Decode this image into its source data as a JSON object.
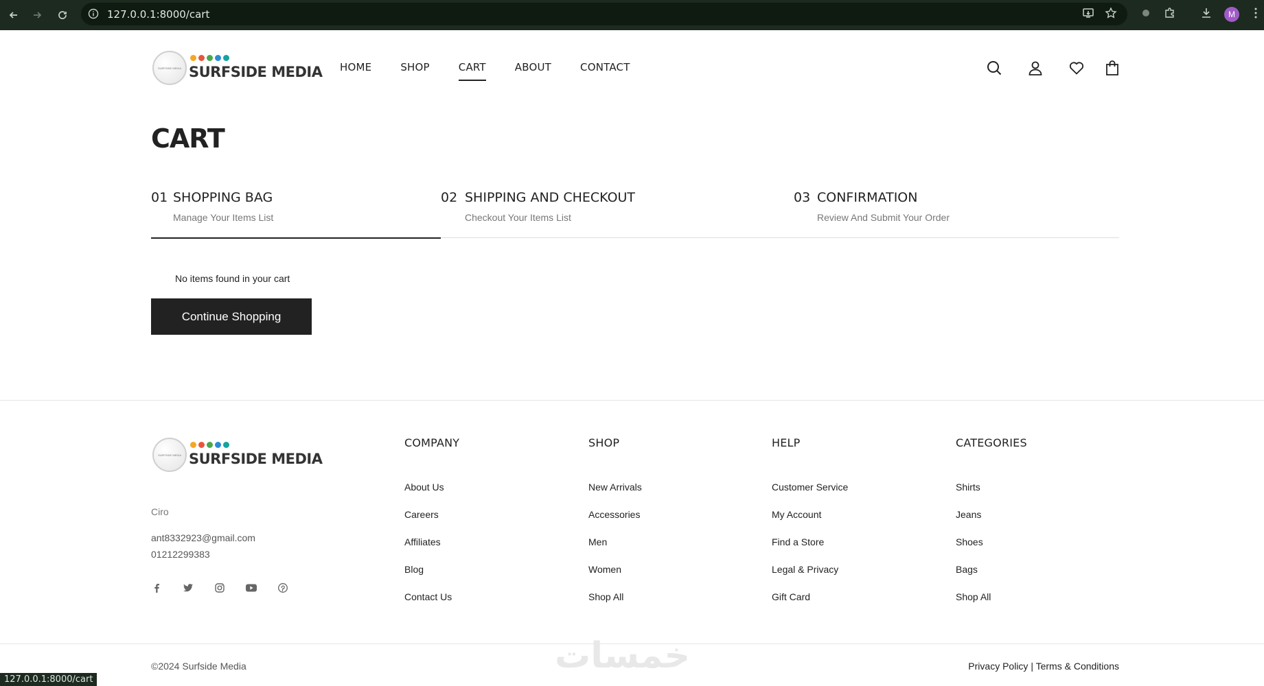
{
  "browser": {
    "url": "127.0.0.1:8000/cart",
    "profile_initial": "M",
    "status_url": "127.0.0.1:8000/cart"
  },
  "brand": {
    "wordmark": "SURFSIDE MEDIA",
    "badge_text": "SURFSIDE MEDIA",
    "dot_colors": [
      "#f5a623",
      "#e8553d",
      "#4aa84f",
      "#2b8bd6",
      "#17a2a2"
    ]
  },
  "nav": {
    "items": [
      {
        "label": "HOME"
      },
      {
        "label": "SHOP"
      },
      {
        "label": "CART"
      },
      {
        "label": "ABOUT"
      },
      {
        "label": "CONTACT"
      }
    ],
    "active": "CART"
  },
  "header_icons": [
    "search-icon",
    "user-icon",
    "heart-icon",
    "bag-icon"
  ],
  "page": {
    "title": "CART",
    "steps": [
      {
        "num": "01",
        "title": "SHOPPING BAG",
        "subtitle": "Manage Your Items List"
      },
      {
        "num": "02",
        "title": "SHIPPING AND CHECKOUT",
        "subtitle": "Checkout Your Items List"
      },
      {
        "num": "03",
        "title": "CONFIRMATION",
        "subtitle": "Review And Submit Your Order"
      }
    ],
    "empty_message": "No items found in your cart",
    "continue_label": "Continue Shopping"
  },
  "footer": {
    "address": "Ciro",
    "email": "ant8332923@gmail.com",
    "phone": "01212299383",
    "socials": [
      "facebook-icon",
      "twitter-icon",
      "instagram-icon",
      "youtube-icon",
      "pinterest-icon"
    ],
    "columns": [
      {
        "heading": "COMPANY",
        "links": [
          "About Us",
          "Careers",
          "Affiliates",
          "Blog",
          "Contact Us"
        ]
      },
      {
        "heading": "SHOP",
        "links": [
          "New Arrivals",
          "Accessories",
          "Men",
          "Women",
          "Shop All"
        ]
      },
      {
        "heading": "HELP",
        "links": [
          "Customer Service",
          "My Account",
          "Find a Store",
          "Legal & Privacy",
          "Gift Card"
        ]
      },
      {
        "heading": "CATEGORIES",
        "links": [
          "Shirts",
          "Jeans",
          "Shoes",
          "Bags",
          "Shop All"
        ]
      }
    ],
    "copyright": "©2024 Surfside Media",
    "privacy": "Privacy Policy",
    "separator": "|",
    "terms": "Terms & Conditions",
    "watermark": "خمسات"
  }
}
